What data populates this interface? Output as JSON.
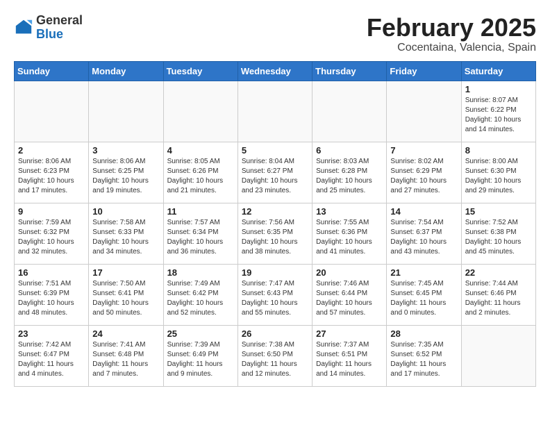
{
  "header": {
    "logo_general": "General",
    "logo_blue": "Blue",
    "month_title": "February 2025",
    "location": "Cocentaina, Valencia, Spain"
  },
  "days_of_week": [
    "Sunday",
    "Monday",
    "Tuesday",
    "Wednesday",
    "Thursday",
    "Friday",
    "Saturday"
  ],
  "weeks": [
    [
      {
        "day": "",
        "info": ""
      },
      {
        "day": "",
        "info": ""
      },
      {
        "day": "",
        "info": ""
      },
      {
        "day": "",
        "info": ""
      },
      {
        "day": "",
        "info": ""
      },
      {
        "day": "",
        "info": ""
      },
      {
        "day": "1",
        "info": "Sunrise: 8:07 AM\nSunset: 6:22 PM\nDaylight: 10 hours and 14 minutes."
      }
    ],
    [
      {
        "day": "2",
        "info": "Sunrise: 8:06 AM\nSunset: 6:23 PM\nDaylight: 10 hours and 17 minutes."
      },
      {
        "day": "3",
        "info": "Sunrise: 8:06 AM\nSunset: 6:25 PM\nDaylight: 10 hours and 19 minutes."
      },
      {
        "day": "4",
        "info": "Sunrise: 8:05 AM\nSunset: 6:26 PM\nDaylight: 10 hours and 21 minutes."
      },
      {
        "day": "5",
        "info": "Sunrise: 8:04 AM\nSunset: 6:27 PM\nDaylight: 10 hours and 23 minutes."
      },
      {
        "day": "6",
        "info": "Sunrise: 8:03 AM\nSunset: 6:28 PM\nDaylight: 10 hours and 25 minutes."
      },
      {
        "day": "7",
        "info": "Sunrise: 8:02 AM\nSunset: 6:29 PM\nDaylight: 10 hours and 27 minutes."
      },
      {
        "day": "8",
        "info": "Sunrise: 8:00 AM\nSunset: 6:30 PM\nDaylight: 10 hours and 29 minutes."
      }
    ],
    [
      {
        "day": "9",
        "info": "Sunrise: 7:59 AM\nSunset: 6:32 PM\nDaylight: 10 hours and 32 minutes."
      },
      {
        "day": "10",
        "info": "Sunrise: 7:58 AM\nSunset: 6:33 PM\nDaylight: 10 hours and 34 minutes."
      },
      {
        "day": "11",
        "info": "Sunrise: 7:57 AM\nSunset: 6:34 PM\nDaylight: 10 hours and 36 minutes."
      },
      {
        "day": "12",
        "info": "Sunrise: 7:56 AM\nSunset: 6:35 PM\nDaylight: 10 hours and 38 minutes."
      },
      {
        "day": "13",
        "info": "Sunrise: 7:55 AM\nSunset: 6:36 PM\nDaylight: 10 hours and 41 minutes."
      },
      {
        "day": "14",
        "info": "Sunrise: 7:54 AM\nSunset: 6:37 PM\nDaylight: 10 hours and 43 minutes."
      },
      {
        "day": "15",
        "info": "Sunrise: 7:52 AM\nSunset: 6:38 PM\nDaylight: 10 hours and 45 minutes."
      }
    ],
    [
      {
        "day": "16",
        "info": "Sunrise: 7:51 AM\nSunset: 6:39 PM\nDaylight: 10 hours and 48 minutes."
      },
      {
        "day": "17",
        "info": "Sunrise: 7:50 AM\nSunset: 6:41 PM\nDaylight: 10 hours and 50 minutes."
      },
      {
        "day": "18",
        "info": "Sunrise: 7:49 AM\nSunset: 6:42 PM\nDaylight: 10 hours and 52 minutes."
      },
      {
        "day": "19",
        "info": "Sunrise: 7:47 AM\nSunset: 6:43 PM\nDaylight: 10 hours and 55 minutes."
      },
      {
        "day": "20",
        "info": "Sunrise: 7:46 AM\nSunset: 6:44 PM\nDaylight: 10 hours and 57 minutes."
      },
      {
        "day": "21",
        "info": "Sunrise: 7:45 AM\nSunset: 6:45 PM\nDaylight: 11 hours and 0 minutes."
      },
      {
        "day": "22",
        "info": "Sunrise: 7:44 AM\nSunset: 6:46 PM\nDaylight: 11 hours and 2 minutes."
      }
    ],
    [
      {
        "day": "23",
        "info": "Sunrise: 7:42 AM\nSunset: 6:47 PM\nDaylight: 11 hours and 4 minutes."
      },
      {
        "day": "24",
        "info": "Sunrise: 7:41 AM\nSunset: 6:48 PM\nDaylight: 11 hours and 7 minutes."
      },
      {
        "day": "25",
        "info": "Sunrise: 7:39 AM\nSunset: 6:49 PM\nDaylight: 11 hours and 9 minutes."
      },
      {
        "day": "26",
        "info": "Sunrise: 7:38 AM\nSunset: 6:50 PM\nDaylight: 11 hours and 12 minutes."
      },
      {
        "day": "27",
        "info": "Sunrise: 7:37 AM\nSunset: 6:51 PM\nDaylight: 11 hours and 14 minutes."
      },
      {
        "day": "28",
        "info": "Sunrise: 7:35 AM\nSunset: 6:52 PM\nDaylight: 11 hours and 17 minutes."
      },
      {
        "day": "",
        "info": ""
      }
    ]
  ]
}
